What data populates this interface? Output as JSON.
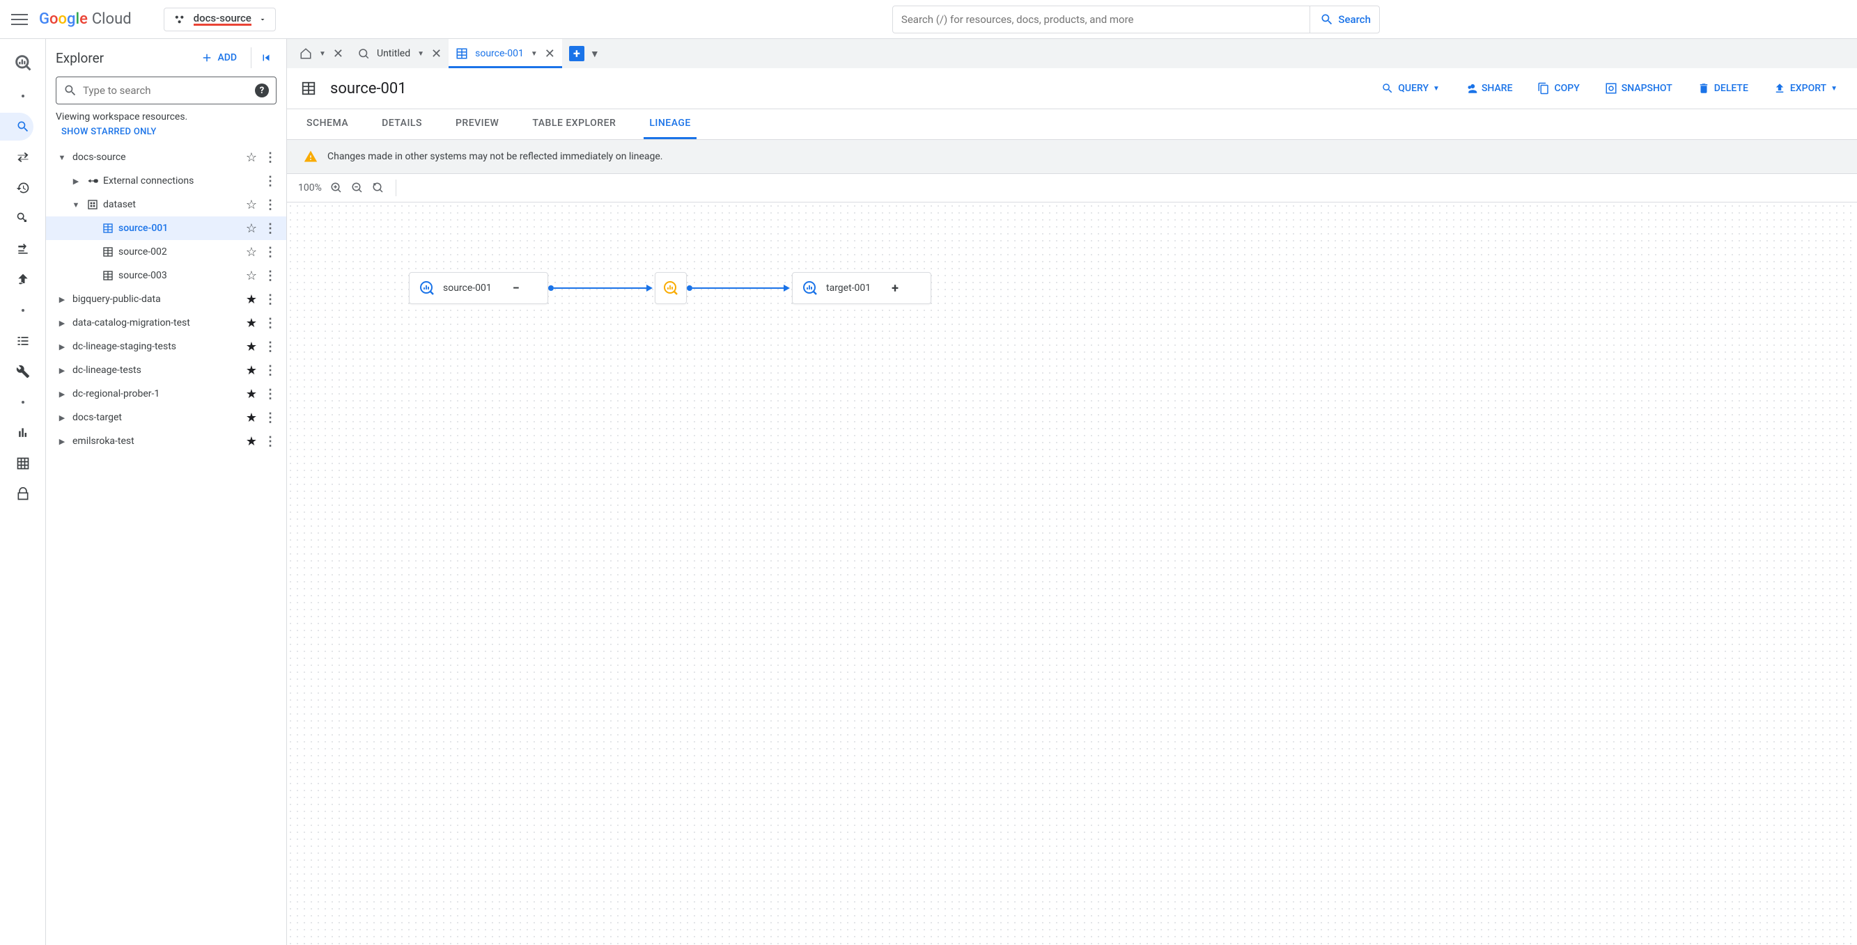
{
  "header": {
    "project": "docs-source",
    "search_placeholder": "Search (/) for resources, docs, products, and more",
    "search_btn": "Search"
  },
  "explorer": {
    "title": "Explorer",
    "add": "ADD",
    "search_placeholder": "Type to search",
    "viewing": "Viewing workspace resources.",
    "starred": "SHOW STARRED ONLY"
  },
  "tree": {
    "project": "docs-source",
    "external": "External connections",
    "dataset": "dataset",
    "tables": [
      "source-001",
      "source-002",
      "source-003"
    ],
    "others": [
      "bigquery-public-data",
      "data-catalog-migration-test",
      "dc-lineage-staging-tests",
      "dc-lineage-tests",
      "dc-regional-prober-1",
      "docs-target",
      "emilsroka-test"
    ]
  },
  "tabs": {
    "untitled": "Untitled",
    "source": "source-001"
  },
  "table": {
    "title": "source-001",
    "actions": {
      "query": "QUERY",
      "share": "SHARE",
      "copy": "COPY",
      "snapshot": "SNAPSHOT",
      "delete": "DELETE",
      "export": "EXPORT"
    },
    "subtabs": {
      "schema": "SCHEMA",
      "details": "DETAILS",
      "preview": "PREVIEW",
      "table_explorer": "TABLE EXPLORER",
      "lineage": "LINEAGE"
    }
  },
  "lineage": {
    "warning": "Changes made in other systems may not be reflected immediately on lineage.",
    "zoom": "100%",
    "nodes": {
      "source": "source-001",
      "target": "target-001"
    }
  }
}
